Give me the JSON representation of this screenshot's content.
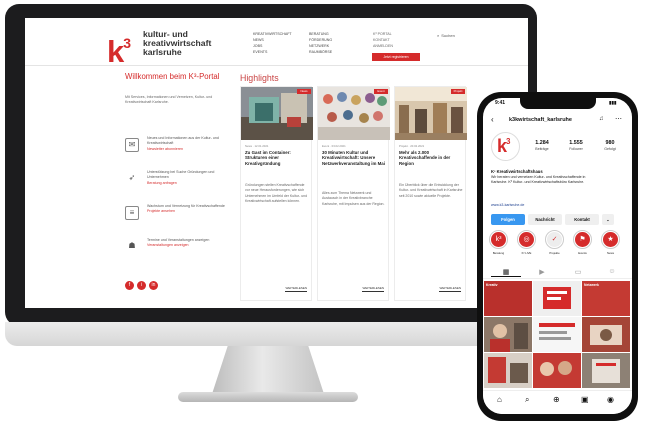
{
  "website": {
    "logo": {
      "mark": "k",
      "sup": "3",
      "line1": "kultur- und",
      "line2": "kreativwirtschaft",
      "line3": "karlsruhe"
    },
    "nav_col1": [
      "Kreativwirtschaft",
      "News",
      "Jobs",
      "Events"
    ],
    "nav_col2": [
      "Beratung",
      "Förderung",
      "Netzwerk",
      "Raumbörse"
    ],
    "nav_col3": [
      "K³ Portal",
      "Kontakt",
      "Anmelden"
    ],
    "cta_label": "Jetzt registrieren",
    "search_label": "Suchen",
    "welcome_title": "Willkommen beim K³-Portal",
    "welcome_intro": "Mit Services, Informationen und Vernetzen, Kultur- und Kreativwirtschaft Karlsruhe.",
    "features": [
      {
        "text": "Neues und Informationen aus der Kultur- und Kreativwirtschaft",
        "link": "Newsletter abonnieren"
      },
      {
        "text": "Unterstützung bei Suche Gründungen und Unternehmen",
        "link": "Beratung anfragen"
      },
      {
        "text": "Wachstum und Vernetzung für Kreativschaffende",
        "link": "Projekte ansehen"
      },
      {
        "text": "Termine und Veranstaltungen anzeigen",
        "link": "Veranstaltungen anzeigen"
      }
    ],
    "social": [
      "f",
      "i",
      "in"
    ],
    "highlights_title": "Highlights",
    "cards": [
      {
        "meta": "News · 12.01.2021",
        "title": "Zu Gast im Container: Strukturen einer Kreativgründung",
        "body": "Gründungen stellen Kreativschaffende vor neue Herausforderungen, wie sich Unternehmen im Umfeld der Kultur- und Kreativwirtschaft aufstellen können.",
        "more": "Weiterlesen",
        "badge": "News"
      },
      {
        "meta": "Event · 03.02.2021",
        "title": "30 Minuten Kultur und Kreativwirtschaft: Unsere Netzwerkveranstaltung im Mai",
        "body": "Alles zum Thema Netzwerk und Austausch in der Kreativbranche Karlsruhe, mit Impulsen aus der Region.",
        "more": "Weiterlesen",
        "badge": "Event"
      },
      {
        "meta": "Projekt · 20.02.2021",
        "title": "Mehr als 2.000 Kreativschaffende in der Region",
        "body": "Ein Überblick über die Entwicklung der Kultur- und Kreativwirtschaft in Karlsruhe seit 2010 sowie aktuelle Projekte.",
        "more": "Weiterlesen",
        "badge": "Projekt"
      }
    ]
  },
  "phone": {
    "time": "9:41",
    "handle": "k3kwirtschaft_karlsruhe",
    "stats": [
      {
        "value": "1.284",
        "label": "Beiträge"
      },
      {
        "value": "1.555",
        "label": "Follower"
      },
      {
        "value": "980",
        "label": "Gefolgt"
      }
    ],
    "bio_name": "K³ Kreativwirtschaftshaus",
    "bio": "Wir beraten und vernetzen Kultur- und Kreativschaffende in Karlsruhe. K³ Kultur- und Kreativwirtschaftsbüro Karlsruhe.",
    "link": "www.k3-karlsruhe.de",
    "btn_follow": "Folgen",
    "btn_message": "Nachricht",
    "btn_contact": "Kontakt",
    "highlights": [
      "Beratung",
      "K³ LIVE",
      "Projekte",
      "Events",
      "News"
    ],
    "grid_labels": [
      "Kreativ",
      "",
      "Netzwerk",
      "",
      "",
      "",
      "",
      "",
      ""
    ]
  },
  "colors": {
    "accent": "#d52b2b",
    "instagram_blue": "#3897f0"
  }
}
